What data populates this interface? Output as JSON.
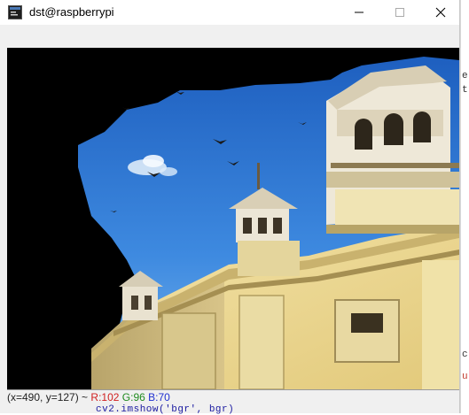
{
  "window": {
    "title": "dst@raspberrypi",
    "controls": {
      "minimize": "minimize-icon",
      "maximize": "maximize-icon",
      "close": "close-icon"
    }
  },
  "image_view": {
    "subject": "building-photo"
  },
  "status": {
    "coords": "(x=490, y=127) ~ ",
    "r": "R:102",
    "g": "G:96",
    "b": "B:70",
    "color_r": "#d02020",
    "color_g": "#1f8a1f",
    "color_b": "#2030d0"
  },
  "background_terminal": {
    "partial_code": "cv2.imshow('bgr', bgr)"
  }
}
